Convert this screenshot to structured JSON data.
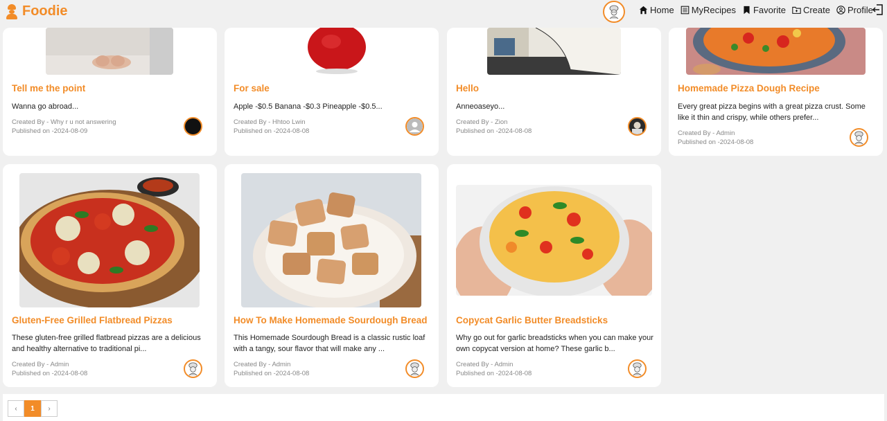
{
  "header": {
    "brand": "Foodie",
    "nav": [
      {
        "label": "Home",
        "icon": "home-icon"
      },
      {
        "label": "MyRecipes",
        "icon": "list-icon"
      },
      {
        "label": "Favorite",
        "icon": "bookmark-icon"
      },
      {
        "label": "Create",
        "icon": "folder-plus-icon"
      },
      {
        "label": "Profile",
        "icon": "user-circle-icon"
      }
    ],
    "logout_icon": "logout-icon"
  },
  "cards": [
    {
      "title": "Tell me the point",
      "desc": "Wanna go abroad...",
      "created_by": "Created By - Why r u not answering",
      "published": "Published on -2024-08-09"
    },
    {
      "title": "For sale",
      "desc": "Apple -$0.5 Banana -$0.3 Pineapple -$0.5...",
      "created_by": "Created By - Hhtoo Lwin",
      "published": "Published on -2024-08-08"
    },
    {
      "title": "Hello",
      "desc": "Anneoaseyo...",
      "created_by": "Created By - Zion",
      "published": "Published on -2024-08-08"
    },
    {
      "title": "Homemade Pizza Dough Recipe",
      "desc": "Every great pizza begins with a great pizza crust. Some like it thin and crispy, while others prefer...",
      "created_by": "Created By - Admin",
      "published": "Published on -2024-08-08"
    },
    {
      "title": "Gluten-Free Grilled Flatbread Pizzas",
      "desc": "These gluten-free grilled flatbread pizzas are a delicious and healthy alternative to traditional pi...",
      "created_by": "Created By - Admin",
      "published": "Published on -2024-08-08"
    },
    {
      "title": "How To Make Homemade Sourdough Bread",
      "desc": "This Homemade Sourdough Bread is a classic rustic loaf with a tangy, sour flavor that will make any ...",
      "created_by": "Created By - Admin",
      "published": "Published on -2024-08-08"
    },
    {
      "title": "Copycat Garlic Butter Breadsticks",
      "desc": "Why go out for garlic breadsticks when you can make your own copycat version at home? These garlic b...",
      "created_by": "Created By - Admin",
      "published": "Published on -2024-08-08"
    }
  ],
  "pagination": {
    "prev": "‹",
    "current": "1",
    "next": "›"
  },
  "colors": {
    "accent": "#f28c28",
    "background": "#f0f0f0"
  }
}
